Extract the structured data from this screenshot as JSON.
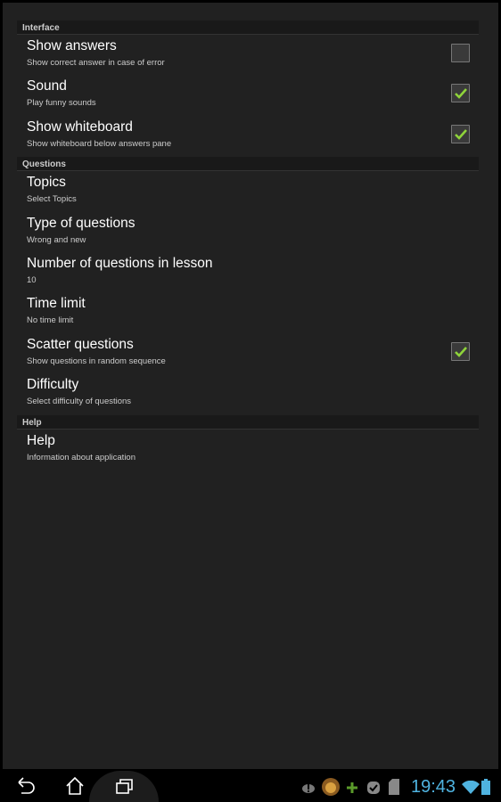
{
  "sections": [
    {
      "header": "Interface",
      "items": [
        {
          "title": "Show answers",
          "summary": "Show correct answer in case of error",
          "checkbox": true,
          "checked": false
        },
        {
          "title": "Sound",
          "summary": "Play funny sounds",
          "checkbox": true,
          "checked": true
        },
        {
          "title": "Show whiteboard",
          "summary": "Show whiteboard below answers pane",
          "checkbox": true,
          "checked": true
        }
      ]
    },
    {
      "header": "Questions",
      "items": [
        {
          "title": "Topics",
          "summary": "Select Topics"
        },
        {
          "title": "Type of questions",
          "summary": "Wrong and new"
        },
        {
          "title": "Number of questions in lesson",
          "summary": "10"
        },
        {
          "title": "Time limit",
          "summary": "No time limit"
        },
        {
          "title": "Scatter questions",
          "summary": "Show questions in random sequence",
          "checkbox": true,
          "checked": true
        },
        {
          "title": "Difficulty",
          "summary": "Select difficulty of questions"
        }
      ]
    },
    {
      "header": "Help",
      "items": [
        {
          "title": "Help",
          "summary": "Information about application"
        }
      ]
    }
  ],
  "status_bar": {
    "time": "19:43",
    "icons": [
      "warning-cloud-icon",
      "lion-app-icon",
      "plus-icon",
      "check-badge-icon",
      "sd-card-icon",
      "wifi-icon",
      "battery-icon"
    ]
  },
  "nav_bar": {
    "icons": [
      "back-icon",
      "home-icon",
      "recent-apps-icon"
    ]
  },
  "colors": {
    "check": "#8fd43a",
    "clock": "#4fb3e0",
    "background": "#212121"
  }
}
